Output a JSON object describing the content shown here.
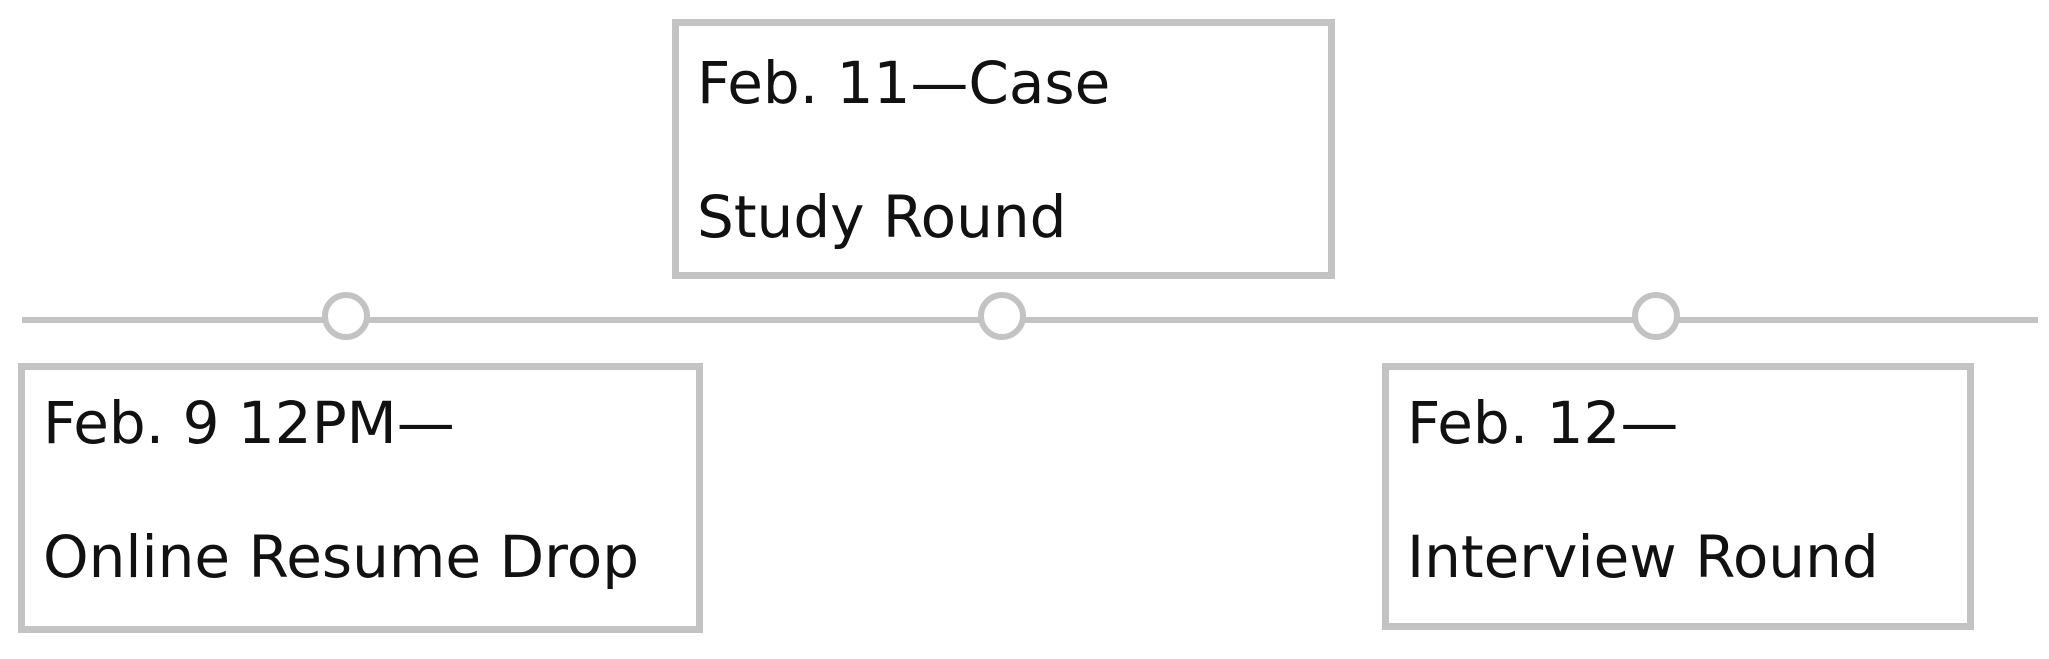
{
  "colors": {
    "line": "#c3c3c3",
    "text": "#111111",
    "background": "#ffffff"
  },
  "timeline": {
    "events": [
      {
        "date_line": "Feb. 9 12PM—",
        "label_line": "Online Resume Drop",
        "position": "below"
      },
      {
        "date_line": "Feb. 11—Case",
        "label_line": "Study Round",
        "position": "above"
      },
      {
        "date_line": "Feb. 12—",
        "label_line": "Interview Round",
        "position": "below"
      }
    ]
  }
}
